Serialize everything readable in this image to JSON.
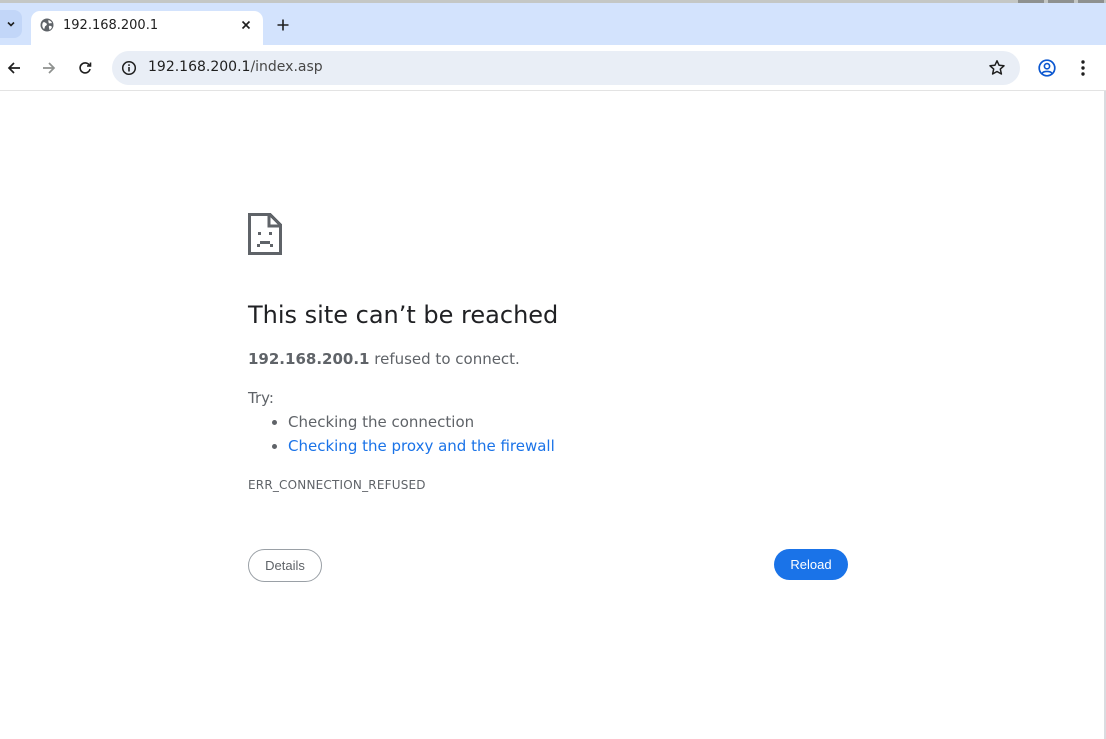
{
  "browser": {
    "tab": {
      "title": "192.168.200.1",
      "favicon": "globe-icon"
    },
    "address_bar": {
      "host": "192.168.200.1",
      "path": "/index.asp"
    }
  },
  "error_page": {
    "heading": "This site can’t be reached",
    "host": "192.168.200.1",
    "message": "refused to connect.",
    "try_label": "Try:",
    "suggestions": [
      "Checking the connection",
      "Checking the proxy and the firewall"
    ],
    "error_code": "ERR_CONNECTION_REFUSED",
    "details_button": "Details",
    "reload_button": "Reload"
  },
  "colors": {
    "tabstrip": "#d3e3fd",
    "omnibox": "#e9eef6",
    "link": "#1a73e8",
    "primary_button": "#1a73e8",
    "text_secondary": "#5f6368"
  }
}
